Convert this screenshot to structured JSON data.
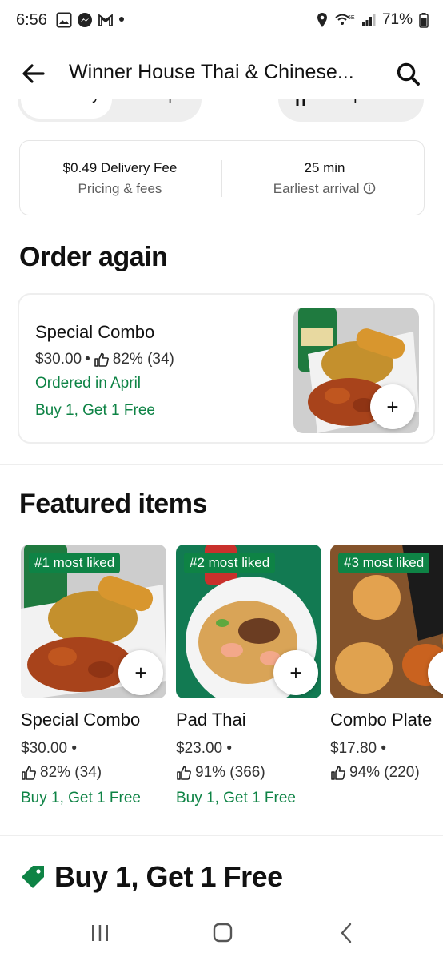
{
  "status_bar": {
    "time": "6:56",
    "battery": "71%",
    "wifi_label": "6E"
  },
  "header": {
    "title": "Winner House Thai & Chinese...",
    "back_icon": "arrow-left-icon",
    "search_icon": "search-icon"
  },
  "mode_toggle": {
    "options": [
      "Delivery",
      "Pickup"
    ],
    "group_order_label": "Group order"
  },
  "info_card": {
    "fee_main": "$0.49 Delivery Fee",
    "fee_sub": "Pricing & fees",
    "arrival_main": "25 min",
    "arrival_sub": "Earliest arrival"
  },
  "order_again": {
    "title": "Order again",
    "item": {
      "name": "Special Combo",
      "price": "$30.00",
      "rating": "82% (34)",
      "ordered": "Ordered in April",
      "promo": "Buy 1, Get 1 Free"
    }
  },
  "featured": {
    "title": "Featured items",
    "items": [
      {
        "badge": "#1 most liked",
        "name": "Special Combo",
        "price": "$30.00 •",
        "rating": "82% (34)",
        "promo": "Buy 1, Get 1 Free"
      },
      {
        "badge": "#2 most liked",
        "name": "Pad Thai",
        "price": "$23.00 •",
        "rating": "91% (366)",
        "promo": "Buy 1, Get 1 Free"
      },
      {
        "badge": "#3 most liked",
        "name": "Combo Plate",
        "price": "$17.80 •",
        "rating": "94% (220)",
        "promo": ""
      }
    ]
  },
  "promo_section": {
    "title": "Buy 1, Get 1 Free"
  },
  "colors": {
    "accent_green": "#0e8345",
    "text": "#111111",
    "muted": "#5e5e5e"
  }
}
